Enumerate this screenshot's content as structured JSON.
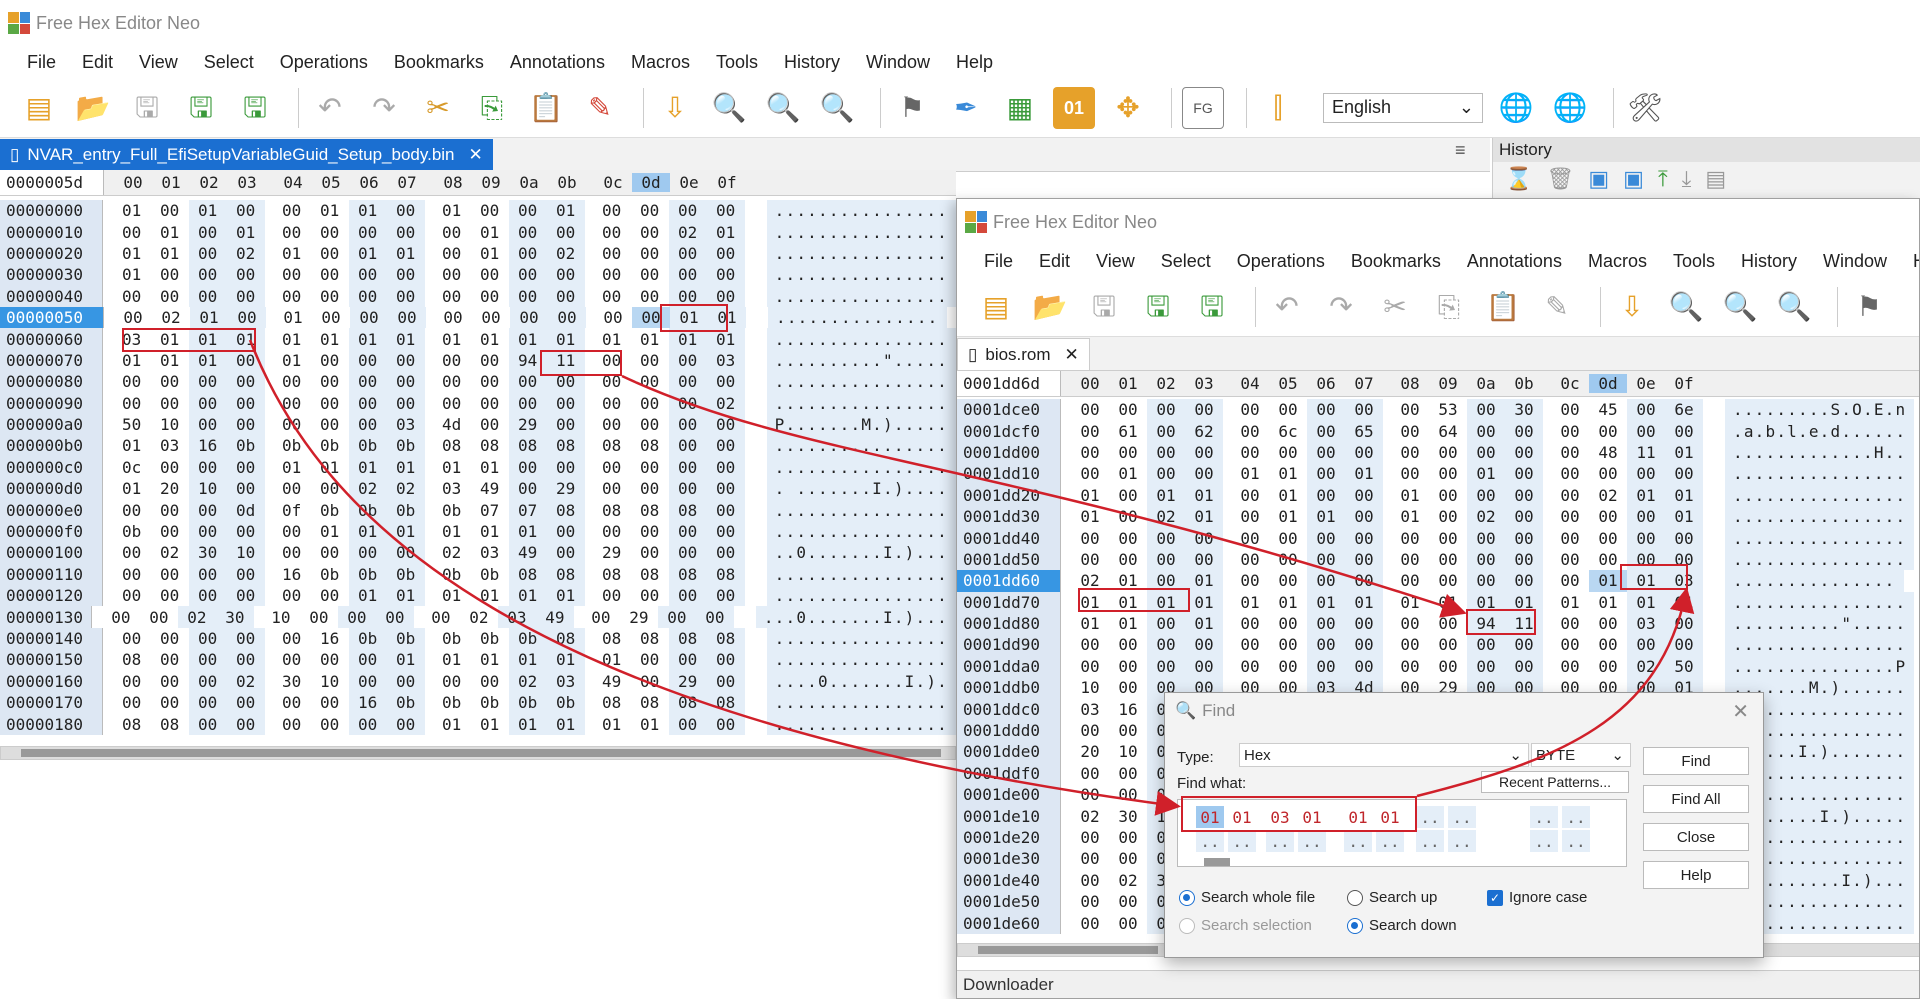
{
  "app_title": "Free Hex Editor Neo",
  "menu": [
    "File",
    "Edit",
    "View",
    "Select",
    "Operations",
    "Bookmarks",
    "Annotations",
    "Macros",
    "Tools",
    "History",
    "Window",
    "Help"
  ],
  "menu2": [
    "File",
    "Edit",
    "View",
    "Select",
    "Operations",
    "Bookmarks",
    "Annotations",
    "Macros",
    "Tools",
    "History",
    "Window",
    "Help"
  ],
  "language": "English",
  "history_title": "History",
  "left": {
    "tab": "NVAR_entry_Full_EfiSetupVariableGuid_Setup_body.bin",
    "offset": "0000005d",
    "cols": [
      "00",
      "01",
      "02",
      "03",
      "04",
      "05",
      "06",
      "07",
      "08",
      "09",
      "0a",
      "0b",
      "0c",
      "0d",
      "0e",
      "0f"
    ],
    "rows": [
      {
        "a": "00000000",
        "h": "01 00 01 00 00 01 01 00 01 00 00 01 00 00 00 00",
        "t": "................"
      },
      {
        "a": "00000010",
        "h": "00 01 00 01 00 00 00 00 00 01 00 00 00 00 02 01",
        "t": "................"
      },
      {
        "a": "00000020",
        "h": "01 01 00 02 01 00 01 01 00 01 00 02 00 00 00 00",
        "t": "................"
      },
      {
        "a": "00000030",
        "h": "01 00 00 00 00 00 00 00 00 00 00 00 00 00 00 00",
        "t": "................"
      },
      {
        "a": "00000040",
        "h": "00 00 00 00 00 00 00 00 00 00 00 00 00 00 00 00",
        "t": "................"
      },
      {
        "a": "00000050",
        "h": "00 02 01 00 01 00 00 00 00 00 00 00 00 00 01 01",
        "t": "..............."
      },
      {
        "a": "00000060",
        "h": "03 01 01 01 01 01 01 01 01 01 01 01 01 01 01 01",
        "t": "................"
      },
      {
        "a": "00000070",
        "h": "01 01 01 00 01 00 00 00 00 00 94 11 00 00 00 03",
        "t": "..........\"....."
      },
      {
        "a": "00000080",
        "h": "00 00 00 00 00 00 00 00 00 00 00 00 00 00 00 00",
        "t": "................"
      },
      {
        "a": "00000090",
        "h": "00 00 00 00 00 00 00 00 00 00 00 00 00 00 00 02",
        "t": "................"
      },
      {
        "a": "000000a0",
        "h": "50 10 00 00 00 00 00 03 4d 00 29 00 00 00 00 00",
        "t": "P.......M.)....."
      },
      {
        "a": "000000b0",
        "h": "01 03 16 0b 0b 0b 0b 0b 08 08 08 08 08 08 00 00",
        "t": "................"
      },
      {
        "a": "000000c0",
        "h": "0c 00 00 00 01 01 01 01 01 01 00 00 00 00 00 00",
        "t": "................"
      },
      {
        "a": "000000d0",
        "h": "01 20 10 00 00 00 02 02 03 49 00 29 00 00 00 00",
        "t": ". .......I.)...."
      },
      {
        "a": "000000e0",
        "h": "00 00 00 0d 0f 0b 0b 0b 0b 07 07 08 08 08 08 00",
        "t": "................"
      },
      {
        "a": "000000f0",
        "h": "0b 00 00 00 00 01 01 01 01 01 01 00 00 00 00 00",
        "t": "................"
      },
      {
        "a": "00000100",
        "h": "00 02 30 10 00 00 00 00 02 03 49 00 29 00 00 00",
        "t": "..0.......I.)..."
      },
      {
        "a": "00000110",
        "h": "00 00 00 00 16 0b 0b 0b 0b 0b 08 08 08 08 08 08",
        "t": "................"
      },
      {
        "a": "00000120",
        "h": "00 00 00 00 00 00 01 01 01 01 01 01 00 00 00 00",
        "t": "................"
      },
      {
        "a": "00000130",
        "h": "00 00 02 30 10 00 00 00 00 02 03 49 00 29 00 00",
        "t": "...0.......I.)..."
      },
      {
        "a": "00000140",
        "h": "00 00 00 00 00 16 0b 0b 0b 0b 0b 08 08 08 08 08",
        "t": "................"
      },
      {
        "a": "00000150",
        "h": "08 00 00 00 00 00 00 01 01 01 01 01 01 00 00 00",
        "t": "................"
      },
      {
        "a": "00000160",
        "h": "00 00 00 02 30 10 00 00 00 00 02 03 49 00 29 00",
        "t": "....0.......I.)."
      },
      {
        "a": "00000170",
        "h": "00 00 00 00 00 00 16 0b 0b 0b 0b 0b 08 08 08 08",
        "t": "................"
      },
      {
        "a": "00000180",
        "h": "08 08 00 00 00 00 00 00 01 01 01 01 01 01 00 00",
        "t": "................"
      }
    ]
  },
  "right": {
    "tab": "bios.rom",
    "offset": "0001dd6d",
    "cols": [
      "00",
      "01",
      "02",
      "03",
      "04",
      "05",
      "06",
      "07",
      "08",
      "09",
      "0a",
      "0b",
      "0c",
      "0d",
      "0e",
      "0f"
    ],
    "rows": [
      {
        "a": "0001dce0",
        "h": "00 00 00 00 00 00 00 00 00 53 00 30 00 45 00 6e",
        "t": ".........S.O.E.n"
      },
      {
        "a": "0001dcf0",
        "h": "00 61 00 62 00 6c 00 65 00 64 00 00 00 00 00 00",
        "t": ".a.b.l.e.d......"
      },
      {
        "a": "0001dd00",
        "h": "00 00 00 00 00 00 00 00 00 00 00 00 00 48 11 01",
        "t": ".............H.."
      },
      {
        "a": "0001dd10",
        "h": "00 01 00 00 01 01 00 01 00 00 01 00 00 00 00 00",
        "t": "................"
      },
      {
        "a": "0001dd20",
        "h": "01 00 01 01 00 01 00 00 01 00 00 00 00 02 01 01",
        "t": "................"
      },
      {
        "a": "0001dd30",
        "h": "01 00 02 01 00 01 01 00 01 00 02 00 00 00 00 01",
        "t": "................"
      },
      {
        "a": "0001dd40",
        "h": "00 00 00 00 00 00 00 00 00 00 00 00 00 00 00 00",
        "t": "................"
      },
      {
        "a": "0001dd50",
        "h": "00 00 00 00 00 00 00 00 00 00 00 00 00 00 00 00",
        "t": "................"
      },
      {
        "a": "0001dd60",
        "h": "02 01 00 01 00 00 00 00 00 00 00 00 00 01 01 03",
        "t": "..............."
      },
      {
        "a": "0001dd70",
        "h": "01 01 01 01 01 01 01 01 01 01 01 01 01 01 01 01",
        "t": "................"
      },
      {
        "a": "0001dd80",
        "h": "01 01 00 01 00 00 00 00 00 00 94 11 00 00 03 00",
        "t": "..........\"....."
      },
      {
        "a": "0001dd90",
        "h": "00 00 00 00 00 00 00 00 00 00 00 00 00 00 00 00",
        "t": "................"
      },
      {
        "a": "0001dda0",
        "h": "00 00 00 00 00 00 00 00 00 00 00 00 00 00 02 50",
        "t": "...............P"
      },
      {
        "a": "0001ddb0",
        "h": "10 00 00 00 00 00 03 4d 00 29 00 00 00 00 00 01",
        "t": ".......M.)......"
      },
      {
        "a": "0001ddc0",
        "h": "03 16 0b 0b 0b 0b 0b 08 08 08 08 08 08 00 00 0c",
        "t": "................"
      },
      {
        "a": "0001ddd0",
        "h": "00 00 00 01 01 01 01 01 01 00 00 00 00 00 00 01",
        "t": "................"
      },
      {
        "a": "0001dde0",
        "h": "20 10 00 00 00 02 02 03 49 00 29 00 00 00 00 00",
        "t": "......I.)......."
      },
      {
        "a": "0001ddf0",
        "h": "00 00 0d 0f 0b 0b 0b 0b 07 07 08 08 08 08 00 0b",
        "t": "................"
      },
      {
        "a": "0001de00",
        "h": "00 00 00 00 01 01 01 01 01 01 00 00 00 00 00 00",
        "t": "................"
      },
      {
        "a": "0001de10",
        "h": "02 30 10 00 00 00 00 02 03 49 00 29 00 00 00 00",
        "t": "........I.)....."
      },
      {
        "a": "0001de20",
        "h": "00 00 00 16 0b 0b 0b 0b 0b 08 08 08 08 08 08 00",
        "t": "................"
      },
      {
        "a": "0001de30",
        "h": "00 00 00 00 00 01 01 01 01 01 01 00 00 00 00 00",
        "t": "................"
      },
      {
        "a": "0001de40",
        "h": "00 02 30 10 00 00 00 00 02 03 49 00 29 00 00 00",
        "t": "..........I.)..."
      },
      {
        "a": "0001de50",
        "h": "00 00 00 00 16 0b 0b 0b 0b 0b 08 08 08 08 08 08",
        "t": "................"
      },
      {
        "a": "0001de60",
        "h": "00 00 00 00 00 00 01 01 01 01 01 01 00 00 00 00",
        "t": "................"
      }
    ]
  },
  "find": {
    "title": "Find",
    "type_label": "Type:",
    "type_value": "Hex",
    "size_value": "BYTE",
    "find_what_label": "Find what:",
    "recent_patterns": "Recent Patterns...",
    "pattern": [
      "01",
      "01",
      "03",
      "01",
      "01",
      "01"
    ],
    "btn_find": "Find",
    "btn_find_all": "Find All",
    "btn_close": "Close",
    "btn_help": "Help",
    "opt_whole_file": "Search whole file",
    "opt_selection": "Search selection",
    "opt_up": "Search up",
    "opt_down": "Search down",
    "opt_ignore_case": "Ignore case"
  },
  "status_text": "Downloader",
  "colors": {
    "accent": "#1b6fd1",
    "highlight": "#d0202a",
    "row_sel": "#3796e3"
  }
}
